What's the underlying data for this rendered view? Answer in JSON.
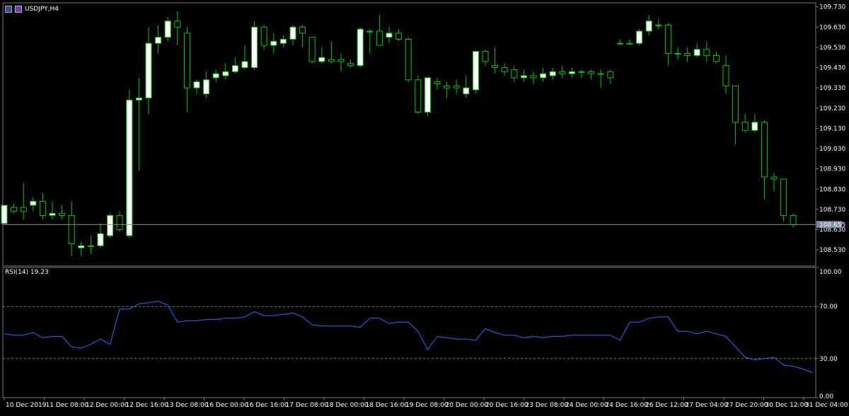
{
  "header": {
    "symbol": "USDJPY,H4"
  },
  "rsi": {
    "label": "RSI(14) 19.23",
    "levels": [
      70,
      30
    ]
  },
  "colors": {
    "background": "#000000",
    "grid": "#7a7a7a",
    "bull": "#ffffff",
    "wick": "#00c800",
    "rsi_line": "#1e6fff",
    "bid_line": "#8c8c8c",
    "bid_tag": "#7a8aa3"
  },
  "chart_data": [
    {
      "type": "candlestick",
      "title": "USDJPY,H4",
      "ylim": [
        108.45,
        109.75
      ],
      "y_ticks": [
        "109.730",
        "109.630",
        "109.530",
        "109.430",
        "109.330",
        "109.230",
        "109.130",
        "109.030",
        "108.930",
        "108.830",
        "108.730",
        "108.630",
        "108.530"
      ],
      "current_price": "108.655",
      "candles": [
        {
          "o": 108.66,
          "h": 108.75,
          "l": 108.66,
          "c": 108.75
        },
        {
          "o": 108.74,
          "h": 108.76,
          "l": 108.71,
          "c": 108.72
        },
        {
          "o": 108.74,
          "h": 108.86,
          "l": 108.68,
          "c": 108.72
        },
        {
          "o": 108.75,
          "h": 108.79,
          "l": 108.72,
          "c": 108.77
        },
        {
          "o": 108.77,
          "h": 108.81,
          "l": 108.68,
          "c": 108.7
        },
        {
          "o": 108.7,
          "h": 108.77,
          "l": 108.68,
          "c": 108.71
        },
        {
          "o": 108.71,
          "h": 108.75,
          "l": 108.68,
          "c": 108.7
        },
        {
          "o": 108.7,
          "h": 108.77,
          "l": 108.5,
          "c": 108.56
        },
        {
          "o": 108.54,
          "h": 108.57,
          "l": 108.5,
          "c": 108.55
        },
        {
          "o": 108.55,
          "h": 108.6,
          "l": 108.51,
          "c": 108.55
        },
        {
          "o": 108.55,
          "h": 108.66,
          "l": 108.54,
          "c": 108.61
        },
        {
          "o": 108.6,
          "h": 108.71,
          "l": 108.59,
          "c": 108.7
        },
        {
          "o": 108.7,
          "h": 108.72,
          "l": 108.62,
          "c": 108.63
        },
        {
          "o": 108.6,
          "h": 109.32,
          "l": 108.59,
          "c": 109.27
        },
        {
          "o": 109.27,
          "h": 109.38,
          "l": 108.92,
          "c": 109.28
        },
        {
          "o": 109.28,
          "h": 109.63,
          "l": 109.2,
          "c": 109.55
        },
        {
          "o": 109.55,
          "h": 109.64,
          "l": 109.5,
          "c": 109.58
        },
        {
          "o": 109.58,
          "h": 109.68,
          "l": 109.56,
          "c": 109.66
        },
        {
          "o": 109.66,
          "h": 109.71,
          "l": 109.54,
          "c": 109.63
        },
        {
          "o": 109.6,
          "h": 109.63,
          "l": 109.21,
          "c": 109.33
        },
        {
          "o": 109.33,
          "h": 109.37,
          "l": 109.3,
          "c": 109.36
        },
        {
          "o": 109.3,
          "h": 109.41,
          "l": 109.28,
          "c": 109.37
        },
        {
          "o": 109.38,
          "h": 109.42,
          "l": 109.36,
          "c": 109.4
        },
        {
          "o": 109.39,
          "h": 109.45,
          "l": 109.37,
          "c": 109.41
        },
        {
          "o": 109.41,
          "h": 109.48,
          "l": 109.4,
          "c": 109.44
        },
        {
          "o": 109.43,
          "h": 109.54,
          "l": 109.42,
          "c": 109.46
        },
        {
          "o": 109.43,
          "h": 109.66,
          "l": 109.42,
          "c": 109.63
        },
        {
          "o": 109.63,
          "h": 109.64,
          "l": 109.52,
          "c": 109.54
        },
        {
          "o": 109.54,
          "h": 109.6,
          "l": 109.5,
          "c": 109.56
        },
        {
          "o": 109.55,
          "h": 109.59,
          "l": 109.53,
          "c": 109.57
        },
        {
          "o": 109.57,
          "h": 109.64,
          "l": 109.54,
          "c": 109.63
        },
        {
          "o": 109.63,
          "h": 109.64,
          "l": 109.53,
          "c": 109.6
        },
        {
          "o": 109.58,
          "h": 109.58,
          "l": 109.45,
          "c": 109.46
        },
        {
          "o": 109.46,
          "h": 109.53,
          "l": 109.45,
          "c": 109.48
        },
        {
          "o": 109.47,
          "h": 109.56,
          "l": 109.45,
          "c": 109.46
        },
        {
          "o": 109.47,
          "h": 109.5,
          "l": 109.41,
          "c": 109.46
        },
        {
          "o": 109.45,
          "h": 109.47,
          "l": 109.43,
          "c": 109.44
        },
        {
          "o": 109.44,
          "h": 109.63,
          "l": 109.43,
          "c": 109.62
        },
        {
          "o": 109.61,
          "h": 109.62,
          "l": 109.5,
          "c": 109.61
        },
        {
          "o": 109.61,
          "h": 109.69,
          "l": 109.56,
          "c": 109.54
        },
        {
          "o": 109.58,
          "h": 109.63,
          "l": 109.55,
          "c": 109.6
        },
        {
          "o": 109.6,
          "h": 109.62,
          "l": 109.56,
          "c": 109.57
        },
        {
          "o": 109.57,
          "h": 109.58,
          "l": 109.36,
          "c": 109.37
        },
        {
          "o": 109.37,
          "h": 109.39,
          "l": 109.2,
          "c": 109.21
        },
        {
          "o": 109.21,
          "h": 109.36,
          "l": 109.19,
          "c": 109.38
        },
        {
          "o": 109.36,
          "h": 109.38,
          "l": 109.32,
          "c": 109.35
        },
        {
          "o": 109.34,
          "h": 109.36,
          "l": 109.28,
          "c": 109.33
        },
        {
          "o": 109.34,
          "h": 109.37,
          "l": 109.3,
          "c": 109.33
        },
        {
          "o": 109.3,
          "h": 109.39,
          "l": 109.28,
          "c": 109.33
        },
        {
          "o": 109.32,
          "h": 109.51,
          "l": 109.3,
          "c": 109.51
        },
        {
          "o": 109.51,
          "h": 109.52,
          "l": 109.44,
          "c": 109.46
        },
        {
          "o": 109.44,
          "h": 109.53,
          "l": 109.4,
          "c": 109.43
        },
        {
          "o": 109.43,
          "h": 109.45,
          "l": 109.39,
          "c": 109.41
        },
        {
          "o": 109.42,
          "h": 109.44,
          "l": 109.36,
          "c": 109.38
        },
        {
          "o": 109.38,
          "h": 109.42,
          "l": 109.36,
          "c": 109.39
        },
        {
          "o": 109.39,
          "h": 109.41,
          "l": 109.35,
          "c": 109.38
        },
        {
          "o": 109.38,
          "h": 109.43,
          "l": 109.36,
          "c": 109.4
        },
        {
          "o": 109.39,
          "h": 109.43,
          "l": 109.37,
          "c": 109.41
        },
        {
          "o": 109.41,
          "h": 109.44,
          "l": 109.38,
          "c": 109.4
        },
        {
          "o": 109.4,
          "h": 109.43,
          "l": 109.38,
          "c": 109.41
        },
        {
          "o": 109.41,
          "h": 109.42,
          "l": 109.38,
          "c": 109.41
        },
        {
          "o": 109.41,
          "h": 109.42,
          "l": 109.37,
          "c": 109.4
        },
        {
          "o": 109.4,
          "h": 109.42,
          "l": 109.33,
          "c": 109.4
        },
        {
          "o": 109.41,
          "h": 109.42,
          "l": 109.35,
          "c": 109.38
        },
        {
          "o": 109.55,
          "h": 109.57,
          "l": 109.54,
          "c": 109.55
        },
        {
          "o": 109.55,
          "h": 109.57,
          "l": 109.54,
          "c": 109.55
        },
        {
          "o": 109.55,
          "h": 109.62,
          "l": 109.54,
          "c": 109.61
        },
        {
          "o": 109.61,
          "h": 109.69,
          "l": 109.59,
          "c": 109.66
        },
        {
          "o": 109.64,
          "h": 109.67,
          "l": 109.62,
          "c": 109.64
        },
        {
          "o": 109.64,
          "h": 109.65,
          "l": 109.44,
          "c": 109.5
        },
        {
          "o": 109.5,
          "h": 109.53,
          "l": 109.47,
          "c": 109.5
        },
        {
          "o": 109.5,
          "h": 109.53,
          "l": 109.46,
          "c": 109.49
        },
        {
          "o": 109.49,
          "h": 109.55,
          "l": 109.48,
          "c": 109.52
        },
        {
          "o": 109.52,
          "h": 109.56,
          "l": 109.46,
          "c": 109.49
        },
        {
          "o": 109.49,
          "h": 109.51,
          "l": 109.45,
          "c": 109.46
        },
        {
          "o": 109.44,
          "h": 109.49,
          "l": 109.3,
          "c": 109.34
        },
        {
          "o": 109.34,
          "h": 109.34,
          "l": 109.05,
          "c": 109.16
        },
        {
          "o": 109.16,
          "h": 109.2,
          "l": 109.11,
          "c": 109.12
        },
        {
          "o": 109.12,
          "h": 109.2,
          "l": 109.11,
          "c": 109.16
        },
        {
          "o": 109.16,
          "h": 109.17,
          "l": 108.78,
          "c": 108.89
        },
        {
          "o": 108.89,
          "h": 108.91,
          "l": 108.82,
          "c": 108.88
        },
        {
          "o": 108.88,
          "h": 108.88,
          "l": 108.67,
          "c": 108.7
        },
        {
          "o": 108.7,
          "h": 108.71,
          "l": 108.64,
          "c": 108.655
        }
      ]
    },
    {
      "type": "line",
      "title": "RSI(14) 19.23",
      "ylim": [
        0,
        100
      ],
      "y_ticks": [
        "100.00",
        "70.00",
        "30.00",
        "0.00"
      ],
      "levels": [
        70,
        30
      ],
      "x_labels": [
        "10 Dec 2019",
        "11 Dec 08:00",
        "12 Dec 00:00",
        "12 Dec 16:00",
        "13 Dec 08:00",
        "16 Dec 00:00",
        "16 Dec 16:00",
        "17 Dec 08:00",
        "18 Dec 00:00",
        "18 Dec 16:00",
        "19 Dec 08:00",
        "20 Dec 00:00",
        "20 Dec 16:00",
        "23 Dec 08:00",
        "24 Dec 00:00",
        "24 Dec 16:00",
        "26 Dec 12:00",
        "27 Dec 04:00",
        "27 Dec 20:00",
        "30 Dec 12:00",
        "31 Dec 04:00"
      ],
      "series": [
        {
          "values": [
            49,
            48,
            48,
            50,
            46,
            47,
            47,
            39,
            38,
            41,
            45,
            41,
            68,
            68,
            72,
            73,
            74,
            71,
            58,
            59,
            59,
            60,
            60,
            61,
            61,
            62,
            66,
            63,
            63,
            64,
            65,
            62,
            56,
            55,
            55,
            55,
            55,
            54,
            61,
            61,
            57,
            58,
            58,
            51,
            37,
            47,
            46,
            45,
            45,
            44,
            53,
            50,
            48,
            48,
            46,
            47,
            46,
            47,
            47,
            48,
            48,
            48,
            48,
            48,
            44,
            58,
            58,
            61,
            62,
            62,
            51,
            51,
            49,
            51,
            49,
            47,
            39,
            31,
            29,
            30,
            31,
            25,
            24,
            22,
            19.23
          ]
        }
      ]
    }
  ]
}
